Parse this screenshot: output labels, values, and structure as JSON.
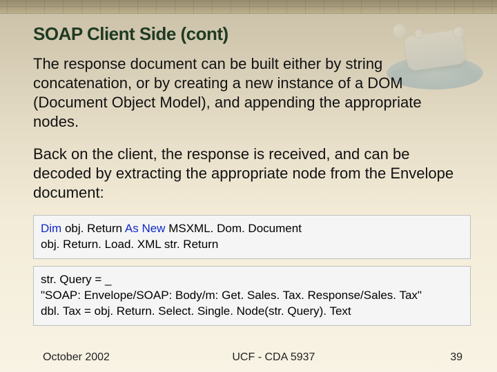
{
  "title": "SOAP Client Side (cont)",
  "para1": "The response document can be built either by string concatenation, or by creating a new instance of a DOM (Document Object Model), and appending the appropriate nodes.",
  "para2": "Back on the client, the response is received, and can be decoded by extracting the appropriate node from the Envelope document:",
  "code1": {
    "kw_dim": "Dim",
    "t1": " obj. Return ",
    "kw_asnew": "As New",
    "t2": " MSXML. Dom. Document",
    "line2": "obj. Return. Load. XML str. Return"
  },
  "code2": {
    "line1": "str. Query = _",
    "line2": "\"SOAP: Envelope/SOAP: Body/m: Get. Sales. Tax. Response/Sales. Tax\"",
    "line3": "dbl. Tax = obj. Return. Select. Single. Node(str. Query). Text"
  },
  "footer": {
    "left": "October 2002",
    "center": "UCF - CDA 5937",
    "right": "39"
  }
}
